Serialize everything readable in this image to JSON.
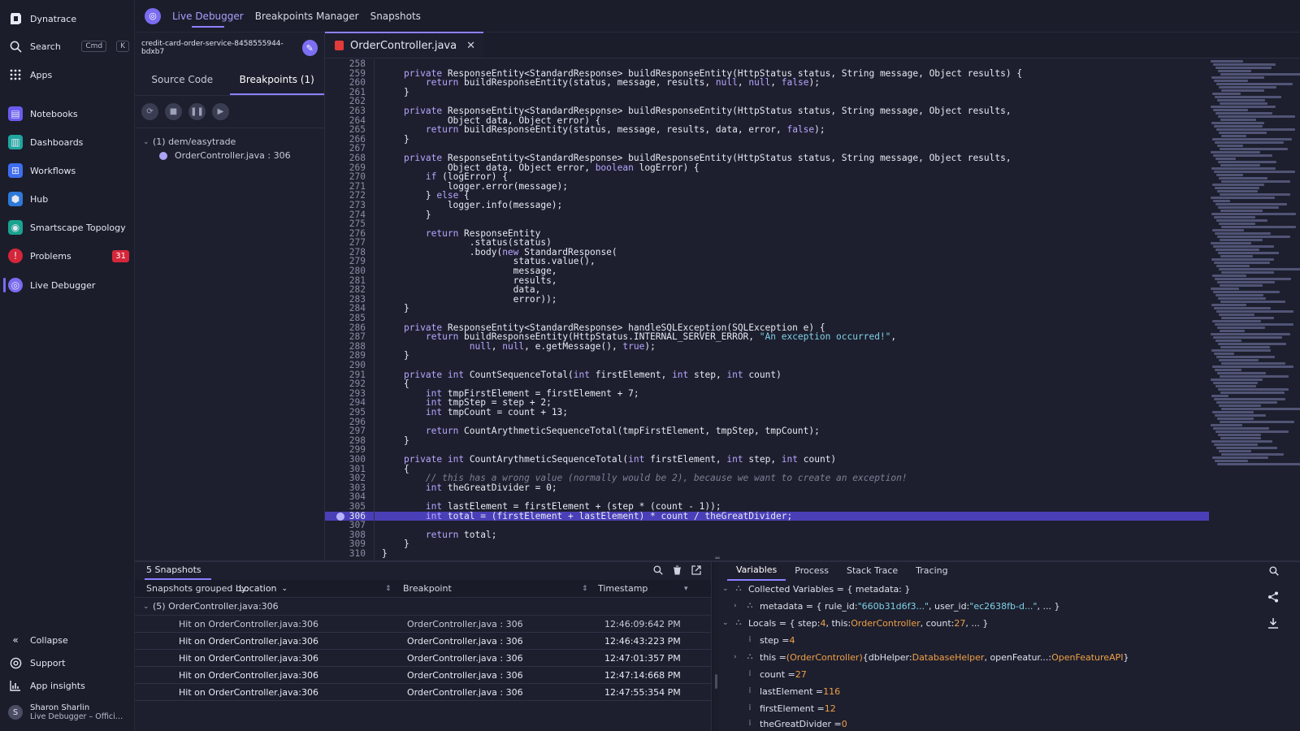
{
  "sidebar": {
    "brand": "Dynatrace",
    "search_label": "Search",
    "search_kbd_1": "Cmd",
    "search_kbd_2": "K",
    "apps_label": "Apps",
    "items": [
      {
        "label": "Notebooks",
        "color": "#6a5cf0"
      },
      {
        "label": "Dashboards",
        "color": "#1fa6a0"
      },
      {
        "label": "Workflows",
        "color": "#3e6df0"
      },
      {
        "label": "Hub",
        "color": "#2d79d8"
      },
      {
        "label": "Smartscape Topology",
        "color": "#19a38f"
      },
      {
        "label": "Problems",
        "color": "#d6263a",
        "badge": "31"
      },
      {
        "label": "Live Debugger",
        "color": "#7a6cf0",
        "active": true
      }
    ],
    "collapse_label": "Collapse",
    "support_label": "Support",
    "insights_label": "App insights",
    "user_name": "Sharon Sharlin",
    "user_sub": "Live Debugger – Official I...",
    "user_initial": "S"
  },
  "topbar": {
    "tabs": [
      "Live Debugger",
      "Breakpoints Manager",
      "Snapshots"
    ]
  },
  "bp_panel": {
    "service": "credit-card-order-service-8458555944-bdxb7",
    "tab_source": "Source Code",
    "tab_breakpoints": "Breakpoints (1)",
    "tree_group": "(1) dem/easytrade",
    "tree_item": "OrderController.java : 306"
  },
  "editor": {
    "file_tab": "OrderController.java",
    "highlight_line": 306,
    "lines": [
      {
        "n": "258",
        "t": ""
      },
      {
        "n": "259",
        "t": "    private ResponseEntity<StandardResponse> buildResponseEntity(HttpStatus status, String message, Object results) {"
      },
      {
        "n": "260",
        "t": "        return buildResponseEntity(status, message, results, null, null, false);"
      },
      {
        "n": "261",
        "t": "    }"
      },
      {
        "n": "262",
        "t": ""
      },
      {
        "n": "263",
        "t": "    private ResponseEntity<StandardResponse> buildResponseEntity(HttpStatus status, String message, Object results,"
      },
      {
        "n": "264",
        "t": "            Object data, Object error) {"
      },
      {
        "n": "265",
        "t": "        return buildResponseEntity(status, message, results, data, error, false);"
      },
      {
        "n": "266",
        "t": "    }"
      },
      {
        "n": "267",
        "t": ""
      },
      {
        "n": "268",
        "t": "    private ResponseEntity<StandardResponse> buildResponseEntity(HttpStatus status, String message, Object results,"
      },
      {
        "n": "269",
        "t": "            Object data, Object error, boolean logError) {"
      },
      {
        "n": "270",
        "t": "        if (logError) {"
      },
      {
        "n": "271",
        "t": "            logger.error(message);"
      },
      {
        "n": "272",
        "t": "        } else {"
      },
      {
        "n": "273",
        "t": "            logger.info(message);"
      },
      {
        "n": "274",
        "t": "        }"
      },
      {
        "n": "275",
        "t": ""
      },
      {
        "n": "276",
        "t": "        return ResponseEntity"
      },
      {
        "n": "277",
        "t": "                .status(status)"
      },
      {
        "n": "278",
        "t": "                .body(new StandardResponse("
      },
      {
        "n": "279",
        "t": "                        status.value(),"
      },
      {
        "n": "280",
        "t": "                        message,"
      },
      {
        "n": "281",
        "t": "                        results,"
      },
      {
        "n": "282",
        "t": "                        data,"
      },
      {
        "n": "283",
        "t": "                        error));"
      },
      {
        "n": "284",
        "t": "    }"
      },
      {
        "n": "285",
        "t": ""
      },
      {
        "n": "286",
        "t": "    private ResponseEntity<StandardResponse> handleSQLException(SQLException e) {"
      },
      {
        "n": "287",
        "t": "        return buildResponseEntity(HttpStatus.INTERNAL_SERVER_ERROR, \"An exception occurred!\","
      },
      {
        "n": "288",
        "t": "                null, null, e.getMessage(), true);"
      },
      {
        "n": "289",
        "t": "    }"
      },
      {
        "n": "290",
        "t": ""
      },
      {
        "n": "291",
        "t": "    private int CountSequenceTotal(int firstElement, int step, int count)"
      },
      {
        "n": "292",
        "t": "    {"
      },
      {
        "n": "293",
        "t": "        int tmpFirstElement = firstElement + 7;"
      },
      {
        "n": "294",
        "t": "        int tmpStep = step + 2;"
      },
      {
        "n": "295",
        "t": "        int tmpCount = count + 13;"
      },
      {
        "n": "296",
        "t": ""
      },
      {
        "n": "297",
        "t": "        return CountArythmeticSequenceTotal(tmpFirstElement, tmpStep, tmpCount);"
      },
      {
        "n": "298",
        "t": "    }"
      },
      {
        "n": "299",
        "t": ""
      },
      {
        "n": "300",
        "t": "    private int CountArythmeticSequenceTotal(int firstElement, int step, int count)"
      },
      {
        "n": "301",
        "t": "    {"
      },
      {
        "n": "302",
        "t": "        // this has a wrong value (normally would be 2), because we want to create an exception!"
      },
      {
        "n": "303",
        "t": "        int theGreatDivider = 0;"
      },
      {
        "n": "304",
        "t": ""
      },
      {
        "n": "305",
        "t": "        int lastElement = firstElement + (step * (count - 1));"
      },
      {
        "n": "306",
        "t": "        int total = (firstElement + lastElement) * count / theGreatDivider;"
      },
      {
        "n": "307",
        "t": ""
      },
      {
        "n": "308",
        "t": "        return total;"
      },
      {
        "n": "309",
        "t": "    }"
      },
      {
        "n": "310",
        "t": "}"
      }
    ]
  },
  "snapshots": {
    "title": "5 Snapshots",
    "grouped_by_label": "Snapshots grouped by:",
    "grouped_by_value": "Location",
    "col_breakpoint": "Breakpoint",
    "col_timestamp": "Timestamp",
    "group_label": "(5) OrderController.java:306",
    "rows": [
      {
        "hit": "Hit on OrderController.java:306",
        "bp": "OrderController.java : 306",
        "ts": "12:46:09:642 PM"
      },
      {
        "hit": "Hit on OrderController.java:306",
        "bp": "OrderController.java : 306",
        "ts": "12:46:43:223 PM"
      },
      {
        "hit": "Hit on OrderController.java:306",
        "bp": "OrderController.java : 306",
        "ts": "12:47:01:357 PM"
      },
      {
        "hit": "Hit on OrderController.java:306",
        "bp": "OrderController.java : 306",
        "ts": "12:47:14:668 PM"
      },
      {
        "hit": "Hit on OrderController.java:306",
        "bp": "OrderController.java : 306",
        "ts": "12:47:55:354 PM"
      }
    ]
  },
  "variables": {
    "tabs": [
      "Variables",
      "Process",
      "Stack Trace",
      "Tracing"
    ],
    "collected": "Collected Variables = { metadata: }",
    "metadata_pre": "metadata = { rule_id: ",
    "metadata_rule": "\"660b31d6f3...\"",
    "metadata_mid": ", user_id: ",
    "metadata_user": "\"ec2638fb-d...\"",
    "metadata_post": ", ... }",
    "locals_pre": "Locals = { step: ",
    "locals_step": "4",
    "locals_mid1": ", this: ",
    "locals_this": "OrderController",
    "locals_mid2": ", count: ",
    "locals_count": "27",
    "locals_post": ", ... }",
    "step_name": "step = ",
    "step_val": "4",
    "this_pre": "this = ",
    "this_type": "(OrderController)",
    "this_mid": " {dbHelper: ",
    "this_db": "DatabaseHelper",
    "this_mid2": ", openFeatur...: ",
    "this_of": "OpenFeatureAPI",
    "this_post": "}",
    "count_name": "count = ",
    "count_val": "27",
    "last_name": "lastElement = ",
    "last_val": "116",
    "first_name": "firstElement = ",
    "first_val": "12",
    "divider_name": "theGreatDivider = ",
    "divider_val": "0"
  }
}
